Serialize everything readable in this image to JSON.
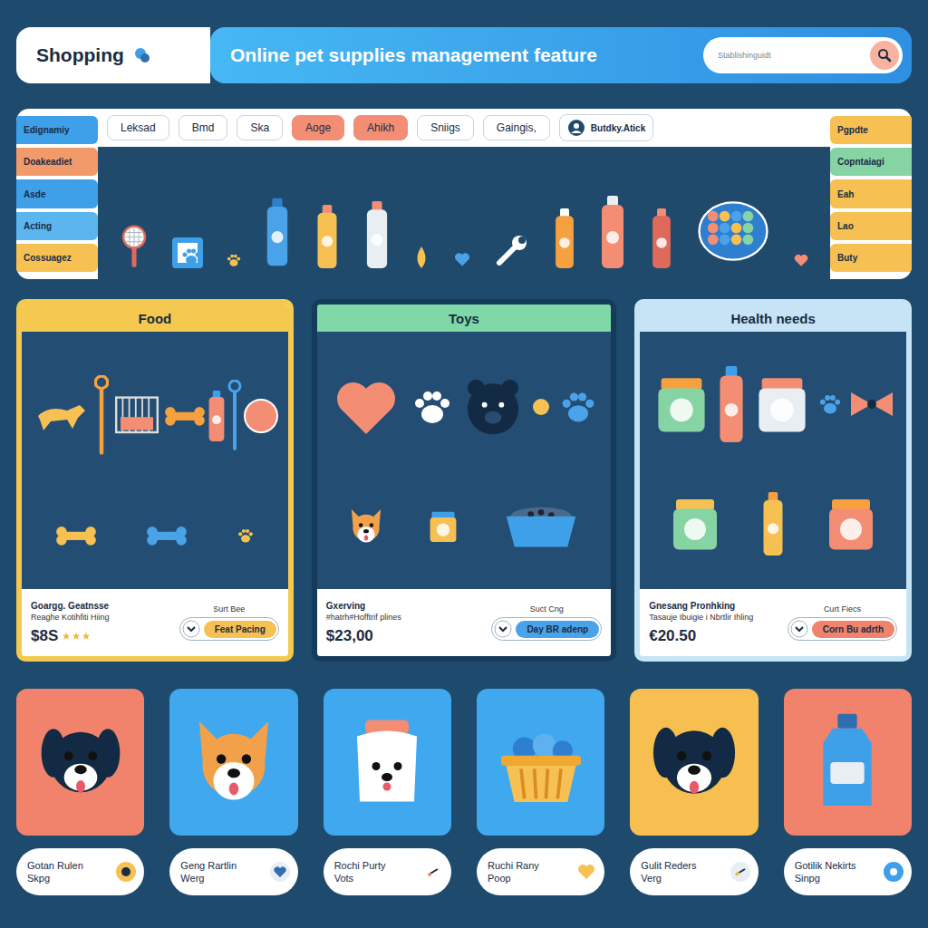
{
  "header": {
    "brand": "Shopping",
    "banner": "Online pet supplies management feature",
    "search": {
      "placeholder": "Stablishinguidt"
    }
  },
  "filters": [
    {
      "label": "Leksad",
      "selected": false
    },
    {
      "label": "Bmd",
      "selected": false
    },
    {
      "label": "Ska",
      "selected": false
    },
    {
      "label": "Aoge",
      "selected": true
    },
    {
      "label": "Ahikh",
      "selected": true
    },
    {
      "label": "Sniigs",
      "selected": false
    },
    {
      "label": "Gaingis,",
      "selected": false
    }
  ],
  "account": {
    "label": "Butdky.Atick"
  },
  "left_tabs": [
    {
      "label": "Edignamiy",
      "color": "#3fa0ea"
    },
    {
      "label": "Doakeadiet",
      "color": "#f39a6b"
    },
    {
      "label": "Asde",
      "color": "#3fa0ea"
    },
    {
      "label": "Acting",
      "color": "#5bb6f0"
    },
    {
      "label": "Cossuagez",
      "color": "#f6c152"
    }
  ],
  "right_tabs": [
    {
      "label": "Pgpdte",
      "color": "#f6c152"
    },
    {
      "label": "Copntaiagi",
      "color": "#86d3a4"
    },
    {
      "label": "Eah",
      "color": "#f6c152"
    },
    {
      "label": "Lao",
      "color": "#f6c152"
    },
    {
      "label": "Buty",
      "color": "#f6c152"
    }
  ],
  "categories": [
    {
      "title": "Food",
      "color": "#f5c94f",
      "name": "Goargg. Geatnsse",
      "desc": "Reaghe Kotihfiti Hiing",
      "price": "$8S",
      "stars": 3,
      "action": "Surt Bee",
      "button": "Feat Pacing",
      "button_color": "#f6c152"
    },
    {
      "title": "Toys",
      "color": "#7ed8a8",
      "name": "Gxerving",
      "desc": "#hatrh#Hofftrif plines",
      "price": "$23,00",
      "stars": 0,
      "action": "Suct Cng",
      "button": "Day BR adenp",
      "button_color": "#4aa3e8"
    },
    {
      "title": "Health needs",
      "color": "#c6e4f6",
      "name": "Gnesang Pronhking",
      "desc": "Tasauje Ibuigie i Nbrtlir Ihling",
      "price": "€20.50",
      "stars": 0,
      "action": "Curt Fiecs",
      "button": "Corn Bu adrth",
      "button_color": "#f1826b"
    }
  ],
  "tiles": [
    {
      "title": "Gotan Rulen",
      "sub": "Skpg",
      "color": "#f1826b"
    },
    {
      "title": "Geng Rartlin",
      "sub": "Werg",
      "color": "#3fa8ee"
    },
    {
      "title": "Rochi Purty",
      "sub": "Vots",
      "color": "#3fa8ee"
    },
    {
      "title": "Ruchi Rany",
      "sub": "Poop",
      "color": "#3fa8ee"
    },
    {
      "title": "Gulit Reders",
      "sub": "Verg",
      "color": "#f6bf4f"
    },
    {
      "title": "Gotilik Nekirts",
      "sub": "Sinpg",
      "color": "#f1826b"
    }
  ]
}
